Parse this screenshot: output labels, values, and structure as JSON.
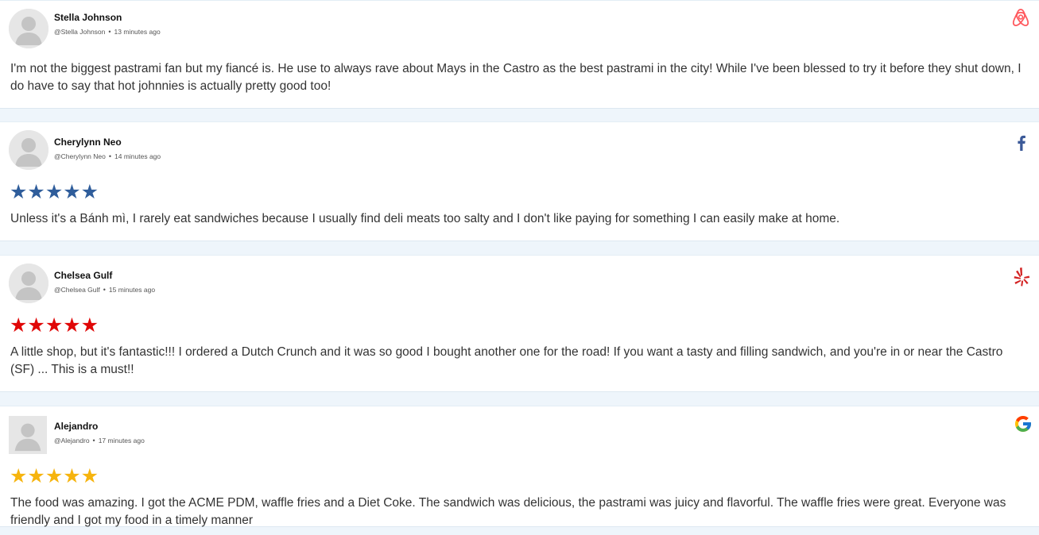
{
  "reviews": [
    {
      "name": "Stella Johnson",
      "handle": "@Stella Johnson",
      "time": "13 minutes ago",
      "source": "airbnb",
      "source_icon": "airbnb-icon",
      "source_color": "#ff5a5f",
      "rating": null,
      "text": "I'm not the biggest pastrami fan but my fiancé is. He use to always rave about Mays in the Castro as the best pastrami in the city! While I've been blessed to try it before they shut down, I do have to say that hot johnnies is actually pretty good too!"
    },
    {
      "name": "Cherylynn Neo",
      "handle": "@Cherylynn Neo",
      "time": "14 minutes ago",
      "source": "facebook",
      "source_icon": "facebook-icon",
      "source_color": "#3b5998",
      "stars": "★★★★★",
      "star_color": "#2f5d9b",
      "rating": 5,
      "text": "Unless it's a Bánh mì, I rarely eat sandwiches because I usually find deli meats too salty and I don't like paying for something I can easily make at home."
    },
    {
      "name": "Chelsea Gulf",
      "handle": "@Chelsea Gulf",
      "time": "15 minutes ago",
      "source": "yelp",
      "source_icon": "yelp-icon",
      "source_color": "#d32323",
      "stars": "★★★★★",
      "star_color": "#e00707",
      "rating": 5,
      "text": "A little shop, but it's fantastic!!! I ordered a Dutch Crunch and it was so good I bought another one for the road! If you want a tasty and filling sandwich, and you're in or near the Castro (SF) ... This is a must!!"
    },
    {
      "name": "Alejandro",
      "handle": "@Alejandro",
      "time": "17 minutes ago",
      "source": "google",
      "source_icon": "google-icon",
      "source_color": "#4285f4",
      "stars": "★★★★★",
      "star_color": "#f6b40e",
      "rating": 5,
      "text": "The food was amazing. I got the ACME PDM, waffle fries and a Diet Coke. The sandwich was delicious, the pastrami was juicy and flavorful. The waffle fries were great. Everyone was friendly and I got my food in a timely manner"
    }
  ]
}
